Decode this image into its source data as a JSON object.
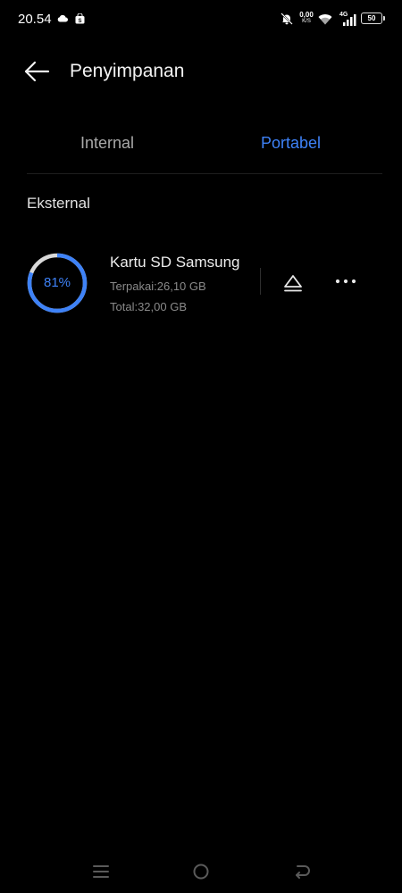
{
  "status_bar": {
    "time": "20.54",
    "speed_value": "0,00",
    "speed_unit": "K/S",
    "network": "4G",
    "battery": "50"
  },
  "header": {
    "title": "Penyimpanan"
  },
  "tabs": [
    {
      "label": "Internal",
      "active": false
    },
    {
      "label": "Portabel",
      "active": true
    }
  ],
  "section": {
    "title": "Eksternal"
  },
  "storage": {
    "percent_label": "81%",
    "used_fraction": 0.81,
    "name": "Kartu SD Samsung",
    "used": "Terpakai:26,10 GB",
    "total": "Total:32,00 GB"
  },
  "colors": {
    "accent": "#3e82f7",
    "ring_track": "#d9d9d9",
    "background": "#000000"
  },
  "icons": {
    "back": "arrow-left-icon",
    "eject": "eject-icon",
    "more": "more-horizontal-icon",
    "nav_menu": "menu-icon",
    "nav_home": "home-circle-icon",
    "nav_back": "return-icon"
  }
}
